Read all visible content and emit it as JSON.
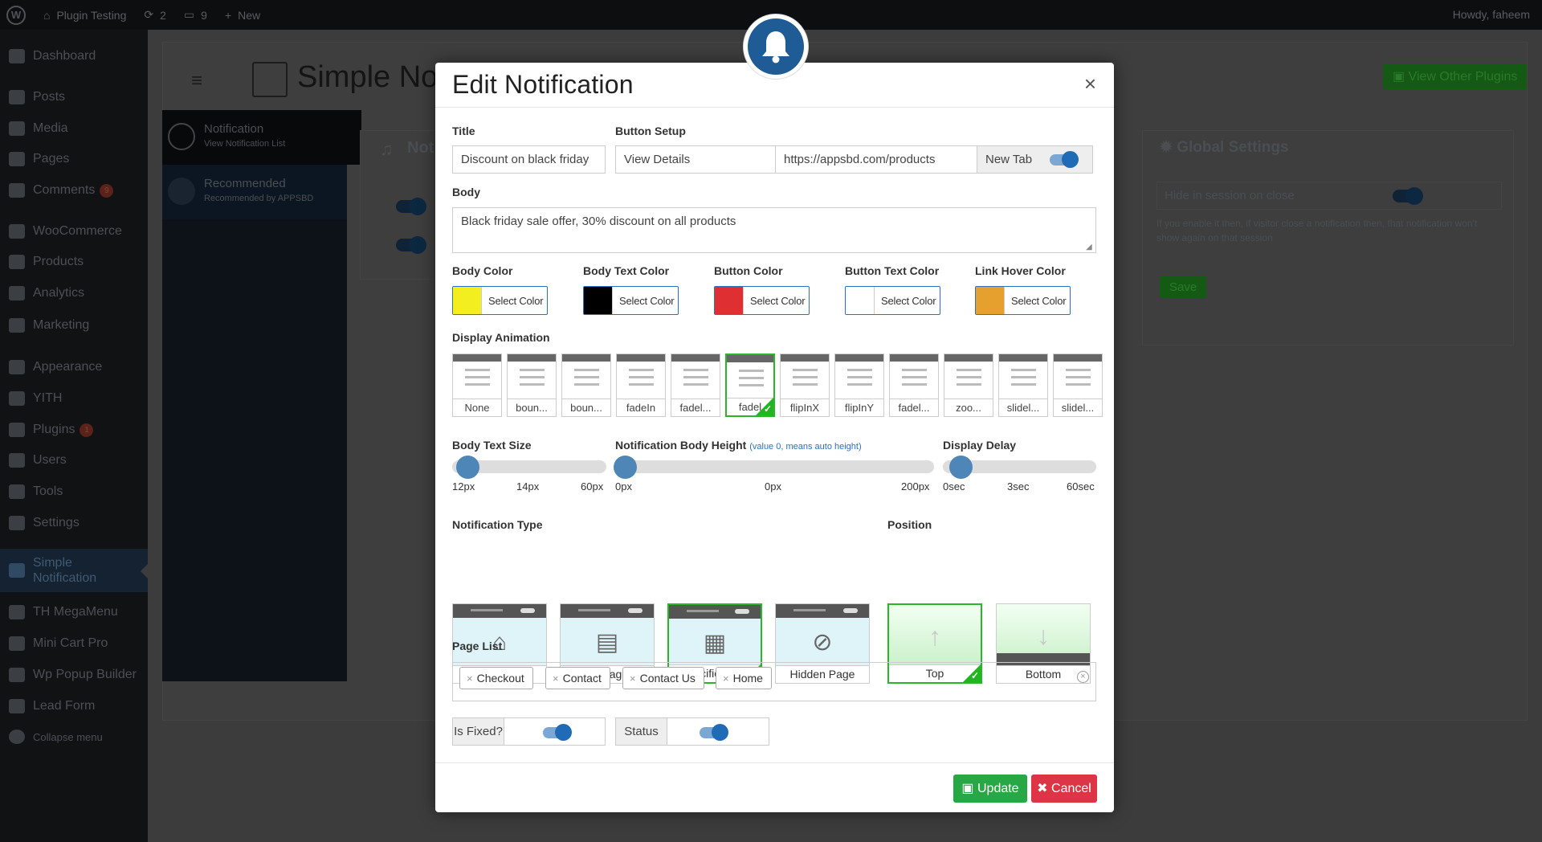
{
  "adminbar": {
    "site_name": "Plugin Testing",
    "updates_count": "2",
    "comments_count": "9",
    "new_label": "New",
    "howdy": "Howdy, faheem"
  },
  "sidebar": {
    "items": [
      {
        "label": "Dashboard"
      },
      {
        "label": "Posts"
      },
      {
        "label": "Media"
      },
      {
        "label": "Pages"
      },
      {
        "label": "Comments",
        "badge": "9"
      },
      {
        "label": "WooCommerce"
      },
      {
        "label": "Products"
      },
      {
        "label": "Analytics"
      },
      {
        "label": "Marketing"
      },
      {
        "label": "Appearance"
      },
      {
        "label": "YITH"
      },
      {
        "label": "Plugins",
        "badge": "1"
      },
      {
        "label": "Users"
      },
      {
        "label": "Tools"
      },
      {
        "label": "Settings"
      },
      {
        "label": "Simple Notification"
      },
      {
        "label": "TH MegaMenu"
      },
      {
        "label": "Mini Cart Pro"
      },
      {
        "label": "Wp Popup Builder"
      },
      {
        "label": "Lead Form"
      },
      {
        "label": "Collapse menu"
      }
    ]
  },
  "background": {
    "page_title": "Simple No",
    "view_other_plugins": "View Other Plugins",
    "nav_notification": "Notification",
    "nav_notification_sub": "View Notification List",
    "nav_recommended": "Recommended",
    "nav_recommended_sub": "Recommended by APPSBD",
    "list_title": "Not",
    "global_settings_title": "Global Settings",
    "hide_in_session": "Hide in session on close",
    "hide_help": "If you enable it then, if visitor close a notification then, that notification won't show again on that session",
    "save_label": "Save"
  },
  "modal": {
    "title": "Edit Notification",
    "close_glyph": "×",
    "title_label": "Title",
    "title_value": "Discount on black friday",
    "button_setup_label": "Button Setup",
    "button_text": "View Details",
    "button_url": "https://appsbd.com/products",
    "new_tab_label": "New Tab",
    "body_label": "Body",
    "body_value": "Black friday sale offer, 30% discount on all products",
    "colors": [
      {
        "label": "Body Color",
        "swatch": "#f2ee1f",
        "button": "Select Color"
      },
      {
        "label": "Body Text Color",
        "swatch": "#000000",
        "button": "Select Color"
      },
      {
        "label": "Button Color",
        "swatch": "#e02f33",
        "button": "Select Color"
      },
      {
        "label": "Button Text Color",
        "swatch": "#ffffff",
        "button": "Select Color"
      },
      {
        "label": "Link Hover Color",
        "swatch": "#e5a02e",
        "button": "Select Color"
      }
    ],
    "display_animation_label": "Display Animation",
    "animations": [
      {
        "label": "None",
        "selected": false
      },
      {
        "label": "boun...",
        "selected": false
      },
      {
        "label": "boun...",
        "selected": false
      },
      {
        "label": "fadeIn",
        "selected": false
      },
      {
        "label": "fadel...",
        "selected": false
      },
      {
        "label": "fadel",
        "selected": true
      },
      {
        "label": "flipInX",
        "selected": false
      },
      {
        "label": "flipInY",
        "selected": false
      },
      {
        "label": "fadel...",
        "selected": false
      },
      {
        "label": "zoo...",
        "selected": false
      },
      {
        "label": "slidel...",
        "selected": false
      },
      {
        "label": "slidel...",
        "selected": false
      }
    ],
    "body_text_size": {
      "label": "Body Text Size",
      "min": "12px",
      "value": "14px",
      "max": "60px"
    },
    "body_height": {
      "label": "Notification Body Height",
      "hint": "(value 0, means auto height)",
      "min": "0px",
      "value": "0px",
      "max": "200px"
    },
    "display_delay": {
      "label": "Display Delay",
      "min": "0sec",
      "value": "3sec",
      "max": "60sec"
    },
    "notification_type_label": "Notification Type",
    "notification_types": [
      {
        "label": "Home Page",
        "icon": "home-icon",
        "glyph": "⌂",
        "selected": false
      },
      {
        "label": "All Page",
        "icon": "document-icon",
        "glyph": "▤",
        "selected": false
      },
      {
        "label": "Specific Page",
        "icon": "qr-page-icon",
        "glyph": "▦",
        "selected": true
      },
      {
        "label": "Hidden Page",
        "icon": "eye-slash-icon",
        "glyph": "⊘",
        "selected": false
      }
    ],
    "position_label": "Position",
    "positions": [
      {
        "label": "Top",
        "icon": "arrow-up-icon",
        "glyph": "↑",
        "selected": true
      },
      {
        "label": "Bottom",
        "icon": "arrow-down-icon",
        "glyph": "↓",
        "selected": false
      }
    ],
    "page_list_label": "Page List",
    "pages": [
      "Checkout",
      "Contact",
      "Contact Us",
      "Home"
    ],
    "is_fixed_label": "Is Fixed?",
    "status_label": "Status",
    "update_label": "Update",
    "cancel_label": "Cancel"
  },
  "colors": {
    "accent": "#2a72c4",
    "toggle_knob": "#1f6bb5",
    "selected_border": "#29b629",
    "update_button": "#28a745",
    "cancel_button": "#dc3545",
    "bell_badge": "#1f5b94"
  }
}
